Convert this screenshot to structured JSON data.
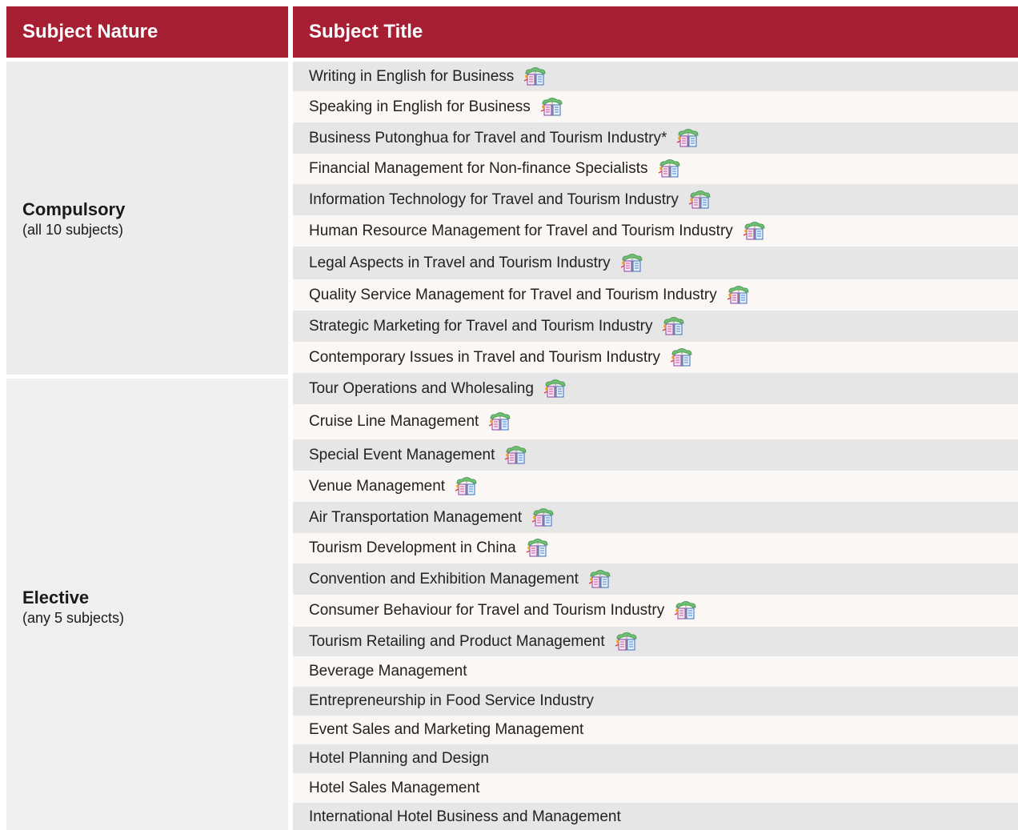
{
  "header": {
    "nature_label": "Subject Nature",
    "title_label": "Subject Title"
  },
  "groups": [
    {
      "label": "Compulsory",
      "sub": "(all 10 subjects)"
    },
    {
      "label": "Elective",
      "sub": "(any 5 subjects)"
    }
  ],
  "subjects": [
    {
      "title": "Writing in English for Business",
      "icon": "course-icon"
    },
    {
      "title": "Speaking in English for Business",
      "icon": "course-icon"
    },
    {
      "title": "Business Putonghua for Travel and Tourism Industry*",
      "icon": "course-icon"
    },
    {
      "title": "Financial Management for Non-finance Specialists",
      "icon": "course-icon"
    },
    {
      "title": "Information Technology for Travel and Tourism Industry",
      "icon": "course-icon"
    },
    {
      "title": "Human Resource Management for Travel and Tourism Industry",
      "icon": "course-icon"
    },
    {
      "title": "Legal Aspects in Travel and Tourism Industry",
      "icon": "course-icon"
    },
    {
      "title": "Quality Service Management for Travel and Tourism Industry",
      "icon": "course-icon"
    },
    {
      "title": "Strategic Marketing for Travel and Tourism Industry",
      "icon": "course-icon"
    },
    {
      "title": "Contemporary Issues in Travel and Tourism Industry",
      "icon": "course-icon"
    },
    {
      "title": "Tour Operations and Wholesaling",
      "icon": "course-icon"
    },
    {
      "title": "Cruise Line Management",
      "icon": "course-icon"
    },
    {
      "title": "Special Event Management",
      "icon": "course-icon"
    },
    {
      "title": "Venue Management",
      "icon": "course-icon"
    },
    {
      "title": "Air Transportation Management",
      "icon": "course-icon"
    },
    {
      "title": "Tourism Development in China",
      "icon": "course-icon"
    },
    {
      "title": "Convention and Exhibition Management",
      "icon": "course-icon"
    },
    {
      "title": "Consumer Behaviour for Travel and Tourism Industry",
      "icon": "course-icon"
    },
    {
      "title": "Tourism Retailing and Product Management",
      "icon": "course-icon"
    },
    {
      "title": "Beverage Management"
    },
    {
      "title": "Entrepreneurship in Food Service Industry"
    },
    {
      "title": "Event Sales and Marketing Management"
    },
    {
      "title": "Hotel Planning and Design"
    },
    {
      "title": "Hotel Sales Management"
    },
    {
      "title": "International Hotel Business and Management"
    }
  ]
}
